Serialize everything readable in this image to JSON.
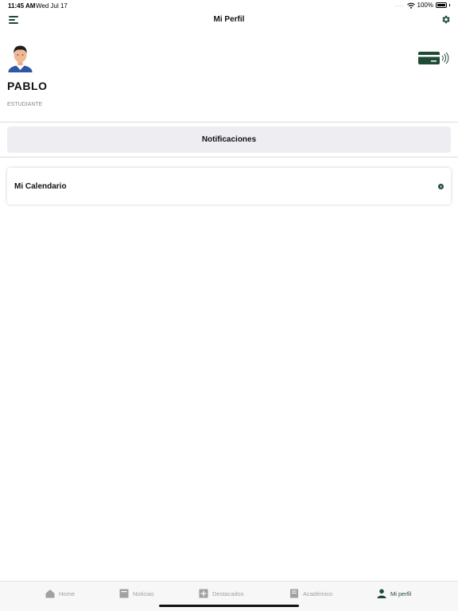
{
  "status_bar": {
    "time": "11:45 AM",
    "date": "Wed Jul 17",
    "signal": "....",
    "battery": "100%"
  },
  "nav": {
    "title": "Mi Perfil",
    "menu_icon": "menu-icon",
    "settings_icon": "gear-icon"
  },
  "profile": {
    "name": "PABLO",
    "role": "ESTUDIANTE",
    "card_icon": "nfc-card-icon"
  },
  "notifications_button": "Notificaciones",
  "calendar_item": {
    "label": "Mi Calendario",
    "icon": "chevron-right-circle-icon"
  },
  "tabs": [
    {
      "label": "Home",
      "icon": "home-icon",
      "active": false
    },
    {
      "label": "Noticias",
      "icon": "news-icon",
      "active": false
    },
    {
      "label": "Destacados",
      "icon": "plus-square-icon",
      "active": false
    },
    {
      "label": "Académico",
      "icon": "book-icon",
      "active": false
    },
    {
      "label": "Mi perfil",
      "icon": "person-icon",
      "active": true
    }
  ],
  "colors": {
    "accent": "#1f4a36",
    "inactive_tab": "#a0a0a0",
    "button_bg": "#eeeef2"
  }
}
